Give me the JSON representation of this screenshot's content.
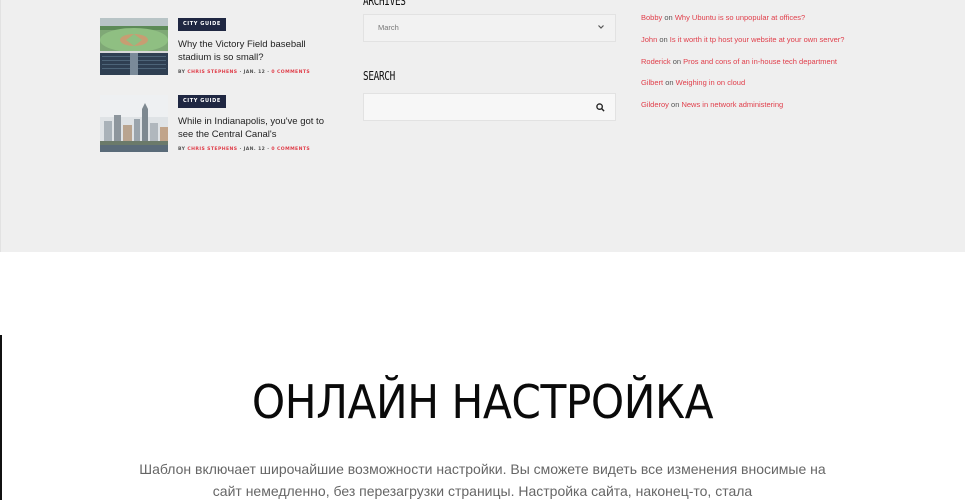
{
  "posts": [
    {
      "category": "City Guide",
      "title": "Why the Victory Field baseball stadium is so small?",
      "by": "by",
      "author": "Chris Stephens",
      "date": "Jan. 12",
      "comments": "0 Comments"
    },
    {
      "category": "City Guide",
      "title": "While in Indianapolis, you've got to see the Central Canal's",
      "by": "by",
      "author": "Chris Stephens",
      "date": "Jan. 12",
      "comments": "0 Comments"
    }
  ],
  "archives": {
    "title": "Archives",
    "selected": "March"
  },
  "search": {
    "title": "Search",
    "placeholder": ""
  },
  "comments": [
    {
      "who": "Bobby",
      "on": "on",
      "post": "Why Ubuntu is so unpopular at offices?"
    },
    {
      "who": "John",
      "on": "on",
      "post": "Is it worth it tp host your website at your own server?"
    },
    {
      "who": "Roderick",
      "on": "on",
      "post": "Pros and cons of an in-house tech department"
    },
    {
      "who": "Gilbert",
      "on": "on",
      "post": "Weighing in on cloud"
    },
    {
      "who": "Gilderoy",
      "on": "on",
      "post": "News in network administering"
    }
  ],
  "section": {
    "title": "ОНЛАЙН НАСТРОЙКА",
    "text": "Шаблон включает широчайшие возможности настройки. Вы сможете видеть все изменения вносимые на сайт немедленно, без перезагрузки страницы. Настройка сайта, наконец-то, стала"
  },
  "colors": {
    "accent": "#e03e4a",
    "badge": "#1f2742",
    "footer_bg": "#efefef"
  },
  "icons": {
    "select_arrow": "chevron-down-icon",
    "search": "search-icon"
  }
}
